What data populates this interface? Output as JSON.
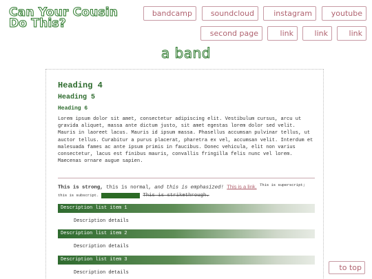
{
  "site": {
    "title_line1": "Can Your Cousin",
    "title_line2": "Do This?"
  },
  "nav": {
    "row1": [
      "bandcamp",
      "soundcloud",
      "instagram",
      "youtube"
    ],
    "row2": [
      "second page",
      "link",
      "link",
      "link"
    ]
  },
  "band_heading": "a band",
  "content": {
    "h4": "Heading 4",
    "h5": "Heading 5",
    "h6": "Heading 6",
    "paragraph": "Lorem ipsum dolor sit amet, consectetur adipiscing elit. Vestibulum cursus, arcu ut gravida aliquet, massa ante dictum justo, sit amet egestas lorem dolor sed velit. Mauris in laoreet lacus. Mauris id ipsum massa. Phasellus accumsan pulvinar tellus, ut auctor tellus. Curabitur a purus placerat, pharetra ex vel, accumsan velit. Interdum et malesuada fames ac ante ipsum primis in faucibus. Donec vehicula, elit non varius consectetur, lacus est finibus mauris, convallis fringilla felis nunc vel lorem. Maecenas ornare augue sapien.",
    "strong": "This is strong,",
    "normal": " this is normal, ",
    "emphasized": "and this is emphasized!",
    "link": "This is a link.",
    "superscript": "This is superscript;",
    "subscript": "this is subscript.",
    "strikethrough": "This is strikethrough."
  },
  "description_list": [
    {
      "term": "Description list item 1",
      "details": "Description details"
    },
    {
      "term": "Description list item 2",
      "details": "Description details"
    },
    {
      "term": "Description list item 3",
      "details": "Description details"
    }
  ],
  "to_top": "to top",
  "colors": {
    "accent_green": "#2e7a2e",
    "link_pink": "#b0626f",
    "border_pink": "#c79aa4"
  }
}
